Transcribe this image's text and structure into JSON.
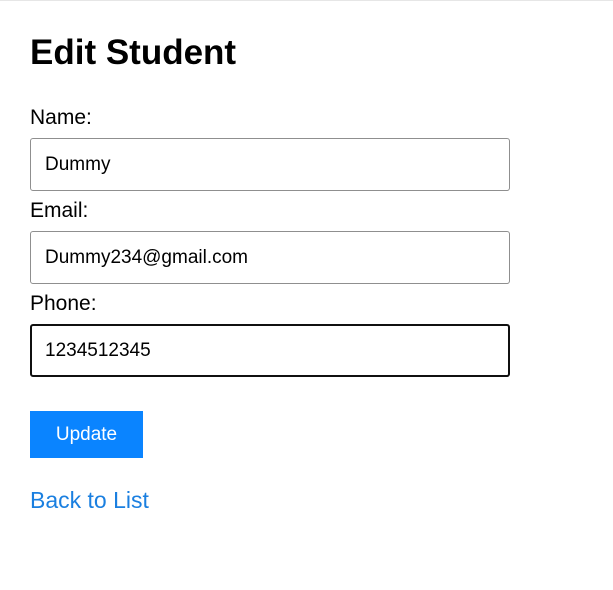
{
  "page": {
    "title": "Edit Student"
  },
  "form": {
    "name_label": "Name:",
    "name_value": "Dummy",
    "email_label": "Email:",
    "email_value": "Dummy234@gmail.com",
    "phone_label": "Phone:",
    "phone_value": "1234512345",
    "focused_field": "phone"
  },
  "actions": {
    "update_label": "Update",
    "back_link_label": "Back to List"
  },
  "colors": {
    "accent": "#0a84ff",
    "link": "#1a7fe0"
  }
}
